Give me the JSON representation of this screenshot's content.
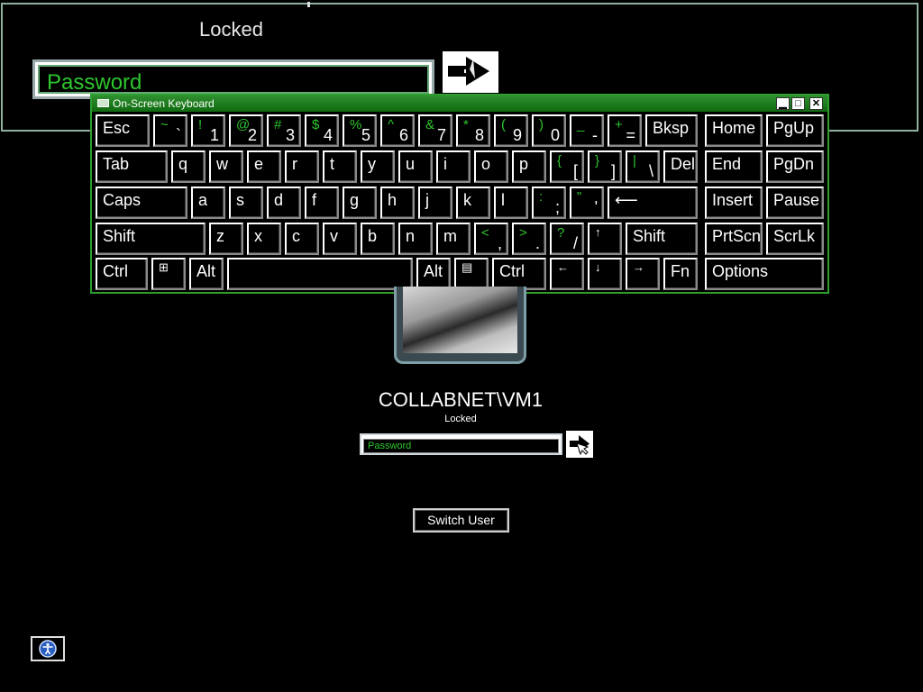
{
  "magnified": {
    "title": "Locked",
    "password_placeholder": "Password"
  },
  "osk": {
    "title": "On-Screen Keyboard",
    "window_buttons": [
      "minimize-icon",
      "maximize-icon",
      "close-icon"
    ],
    "rows": [
      [
        {
          "label": "Esc"
        },
        {
          "shift": "~",
          "base": "`"
        },
        {
          "shift": "!",
          "base": "1"
        },
        {
          "shift": "@",
          "base": "2"
        },
        {
          "shift": "#",
          "base": "3"
        },
        {
          "shift": "$",
          "base": "4"
        },
        {
          "shift": "%",
          "base": "5"
        },
        {
          "shift": "^",
          "base": "6"
        },
        {
          "shift": "&",
          "base": "7"
        },
        {
          "shift": "*",
          "base": "8"
        },
        {
          "shift": "(",
          "base": "9"
        },
        {
          "shift": ")",
          "base": "0"
        },
        {
          "shift": "_",
          "base": "-"
        },
        {
          "shift": "+",
          "base": "="
        },
        {
          "label": "Bksp"
        },
        {
          "label": "Home"
        },
        {
          "label": "PgUp"
        }
      ],
      [
        {
          "label": "Tab"
        },
        {
          "label": "q"
        },
        {
          "label": "w"
        },
        {
          "label": "e"
        },
        {
          "label": "r"
        },
        {
          "label": "t"
        },
        {
          "label": "y"
        },
        {
          "label": "u"
        },
        {
          "label": "i"
        },
        {
          "label": "o"
        },
        {
          "label": "p"
        },
        {
          "shift": "{",
          "base": "["
        },
        {
          "shift": "}",
          "base": "]"
        },
        {
          "shift": "|",
          "base": "\\"
        },
        {
          "label": "Del"
        },
        {
          "label": "End"
        },
        {
          "label": "PgDn"
        }
      ],
      [
        {
          "label": "Caps"
        },
        {
          "label": "a"
        },
        {
          "label": "s"
        },
        {
          "label": "d"
        },
        {
          "label": "f"
        },
        {
          "label": "g"
        },
        {
          "label": "h"
        },
        {
          "label": "j"
        },
        {
          "label": "k"
        },
        {
          "label": "l"
        },
        {
          "shift": ":",
          "base": ";"
        },
        {
          "shift": "\"",
          "base": "'"
        },
        {
          "label": "⟵"
        },
        {
          "label": "Insert"
        },
        {
          "label": "Pause"
        }
      ],
      [
        {
          "label": "Shift"
        },
        {
          "label": "z"
        },
        {
          "label": "x"
        },
        {
          "label": "c"
        },
        {
          "label": "v"
        },
        {
          "label": "b"
        },
        {
          "label": "n"
        },
        {
          "label": "m"
        },
        {
          "shift": "<",
          "base": ","
        },
        {
          "shift": ">",
          "base": "."
        },
        {
          "shift": "?",
          "base": "/"
        },
        {
          "label": "↑"
        },
        {
          "label": "Shift"
        },
        {
          "label": "PrtScn"
        },
        {
          "label": "ScrLk"
        }
      ],
      [
        {
          "label": "Ctrl"
        },
        {
          "label": "",
          "icon": "windows-icon"
        },
        {
          "label": "Alt"
        },
        {
          "label": ""
        },
        {
          "label": "Alt"
        },
        {
          "label": "",
          "icon": "menu-icon"
        },
        {
          "label": "Ctrl"
        },
        {
          "label": "←"
        },
        {
          "label": "↓"
        },
        {
          "label": "→"
        },
        {
          "label": "Fn"
        },
        {
          "label": "Options"
        }
      ]
    ]
  },
  "login": {
    "username": "COLLABNET\\VM1",
    "status": "Locked",
    "password_placeholder": "Password",
    "switch_user_label": "Switch User"
  },
  "colors": {
    "accent_green": "#2ec62e",
    "titlebar_green": "#1b7f1b"
  }
}
